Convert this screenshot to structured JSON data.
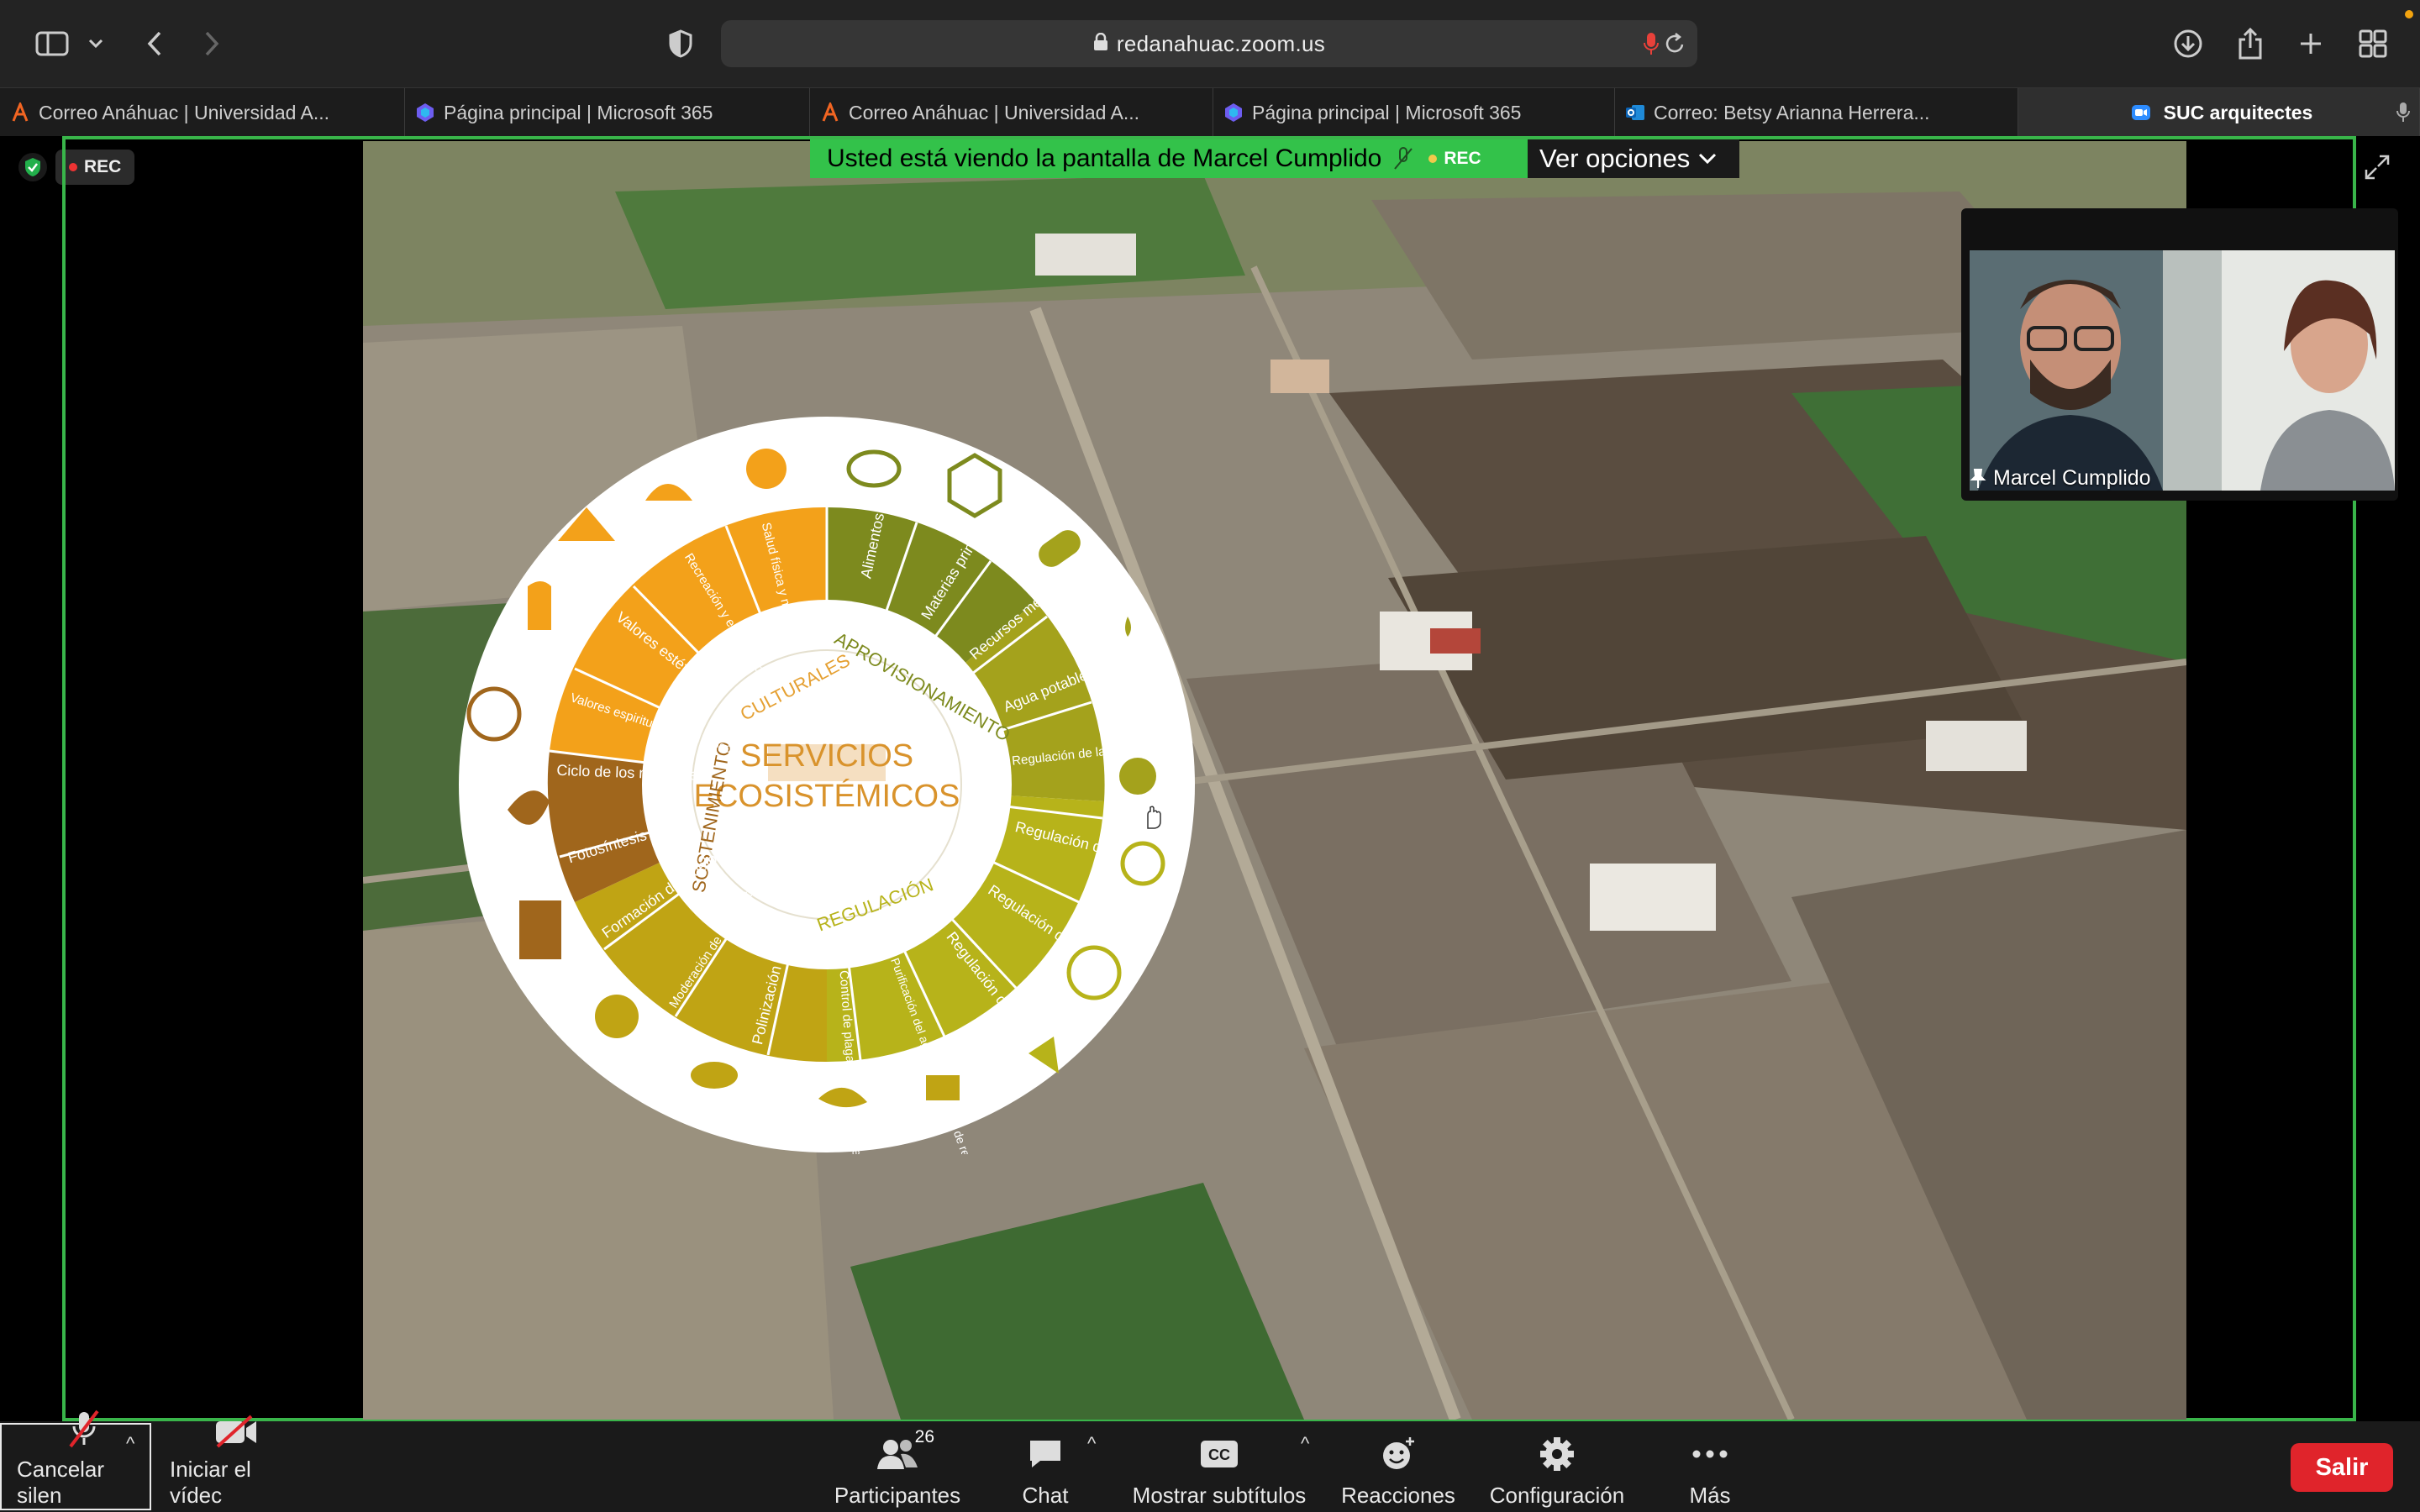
{
  "browser": {
    "url": "redanahuac.zoom.us",
    "tabs": [
      {
        "label": "Correo Anáhuac | Universidad A...",
        "icon": "anahuac-logo-icon",
        "active": false
      },
      {
        "label": "Página principal | Microsoft 365",
        "icon": "microsoft365-icon",
        "active": false
      },
      {
        "label": "Correo Anáhuac | Universidad A...",
        "icon": "anahuac-logo-icon",
        "active": false
      },
      {
        "label": "Página principal | Microsoft 365",
        "icon": "microsoft365-icon",
        "active": false
      },
      {
        "label": "Correo: Betsy Arianna Herrera...",
        "icon": "outlook-icon",
        "active": false
      },
      {
        "label": "SUC arquitectes",
        "icon": "zoom-icon",
        "active": true
      }
    ]
  },
  "meeting": {
    "rec_label": "REC",
    "banner_text": "Usted está viendo la pantalla de Marcel Cumplido",
    "banner_rec": "REC",
    "view_options": "Ver opciones",
    "participant_name": "Marcel Cumplido",
    "participant_count": "26"
  },
  "slide": {
    "center_line1": "SERVICIOS",
    "center_line2": "ECOSISTÉMICOS",
    "ring_labels": {
      "culturales": "CULTURALES",
      "aprovisionamiento": "APROVISIONAMIENTO",
      "regulacion": "REGULACIÓN",
      "sostenimiento": "SOSTENIMIENTO"
    },
    "segments": [
      "Alimentos",
      "Materias primas",
      "Recursos medicinales",
      "Agua potable",
      "Regulación de la calidad del aire",
      "Regulación del clima",
      "Regulación del agua",
      "Regulación de la erosión",
      "Purificación del agua y tratamiento de residuos",
      "Control de plagas y enfermedades",
      "Polinización",
      "Moderación de los eventos extremos",
      "Formación del suelo",
      "Fotosíntesis",
      "Ciclo de los nutrientes",
      "Valores espirituales y religiosos",
      "Valores estéticos",
      "Recreación y ecoturismo",
      "Salud física y mental"
    ]
  },
  "controls": {
    "mute": "Cancelar silen",
    "video": "Iniciar el vídec",
    "participants": "Participantes",
    "chat": "Chat",
    "captions": "Mostrar subtítulos",
    "reactions": "Reacciones",
    "settings": "Configuración",
    "more": "Más",
    "leave": "Salir"
  },
  "colors": {
    "share_border": "#39b54a",
    "banner_green": "#33c24a",
    "leave_red": "#e0242b",
    "orange": "#f3a11a",
    "olive": "#7d8a1e",
    "lime": "#b7b31a",
    "brown": "#a0661c"
  }
}
